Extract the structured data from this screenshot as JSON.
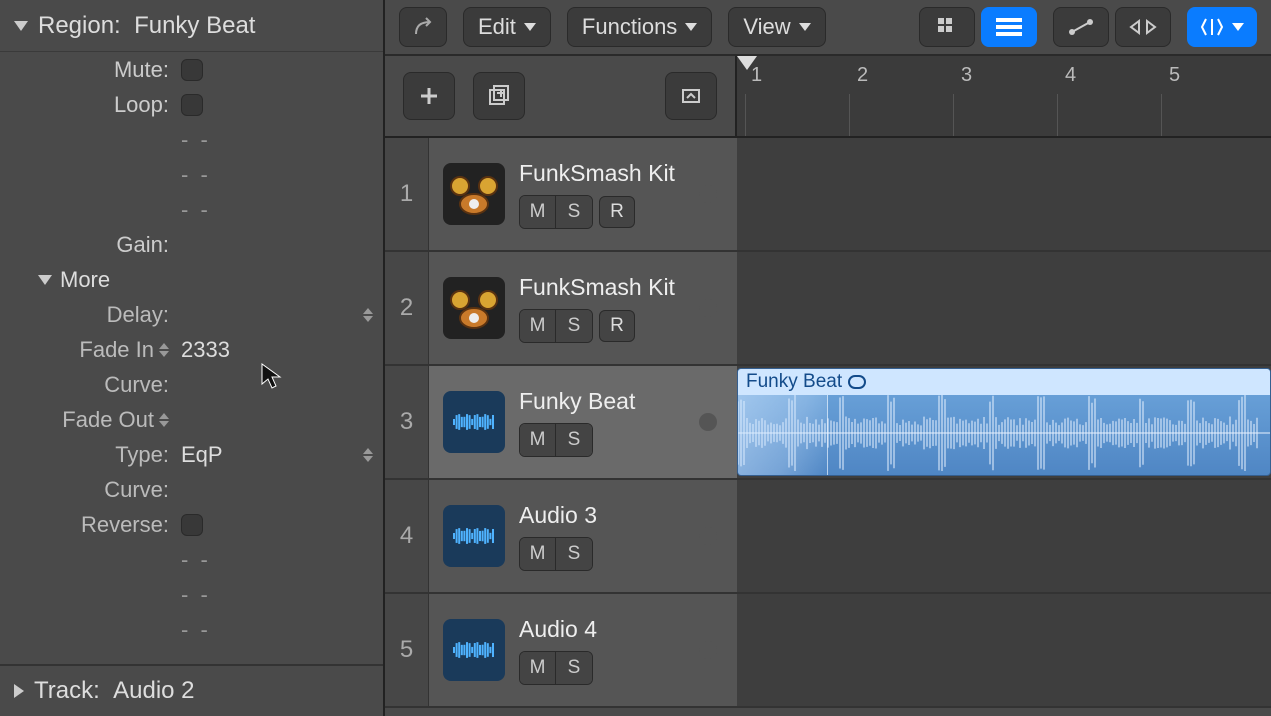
{
  "inspector": {
    "region_header_prefix": "Region:",
    "region_header_name": "Funky Beat",
    "rows": {
      "mute_label": "Mute:",
      "loop_label": "Loop:",
      "gain_label": "Gain:",
      "blank": "-  -"
    },
    "more_label": "More",
    "more": {
      "delay_label": "Delay:",
      "fadein_label": "Fade In",
      "fadein_value": "2333",
      "curve1_label": "Curve:",
      "fadeout_label": "Fade Out",
      "type_label": "Type:",
      "type_value": "EqP",
      "curve2_label": "Curve:",
      "reverse_label": "Reverse:"
    },
    "track_footer_prefix": "Track:",
    "track_footer_name": "Audio 2"
  },
  "toolbar": {
    "edit_label": "Edit",
    "functions_label": "Functions",
    "view_label": "View"
  },
  "ruler": {
    "ticks": [
      "1",
      "2",
      "3",
      "4",
      "5"
    ]
  },
  "tracks": [
    {
      "num": "1",
      "name": "FunkSmash Kit",
      "icon": "drum",
      "hasR": true
    },
    {
      "num": "2",
      "name": "FunkSmash Kit",
      "icon": "drum",
      "hasR": true
    },
    {
      "num": "3",
      "name": "Funky Beat",
      "icon": "wave",
      "hasR": false,
      "selected": true,
      "region_name": "Funky Beat"
    },
    {
      "num": "4",
      "name": "Audio 3",
      "icon": "wave",
      "hasR": false
    },
    {
      "num": "5",
      "name": "Audio 4",
      "icon": "wave",
      "hasR": false
    }
  ],
  "btn_labels": {
    "m": "M",
    "s": "S",
    "r": "R"
  }
}
